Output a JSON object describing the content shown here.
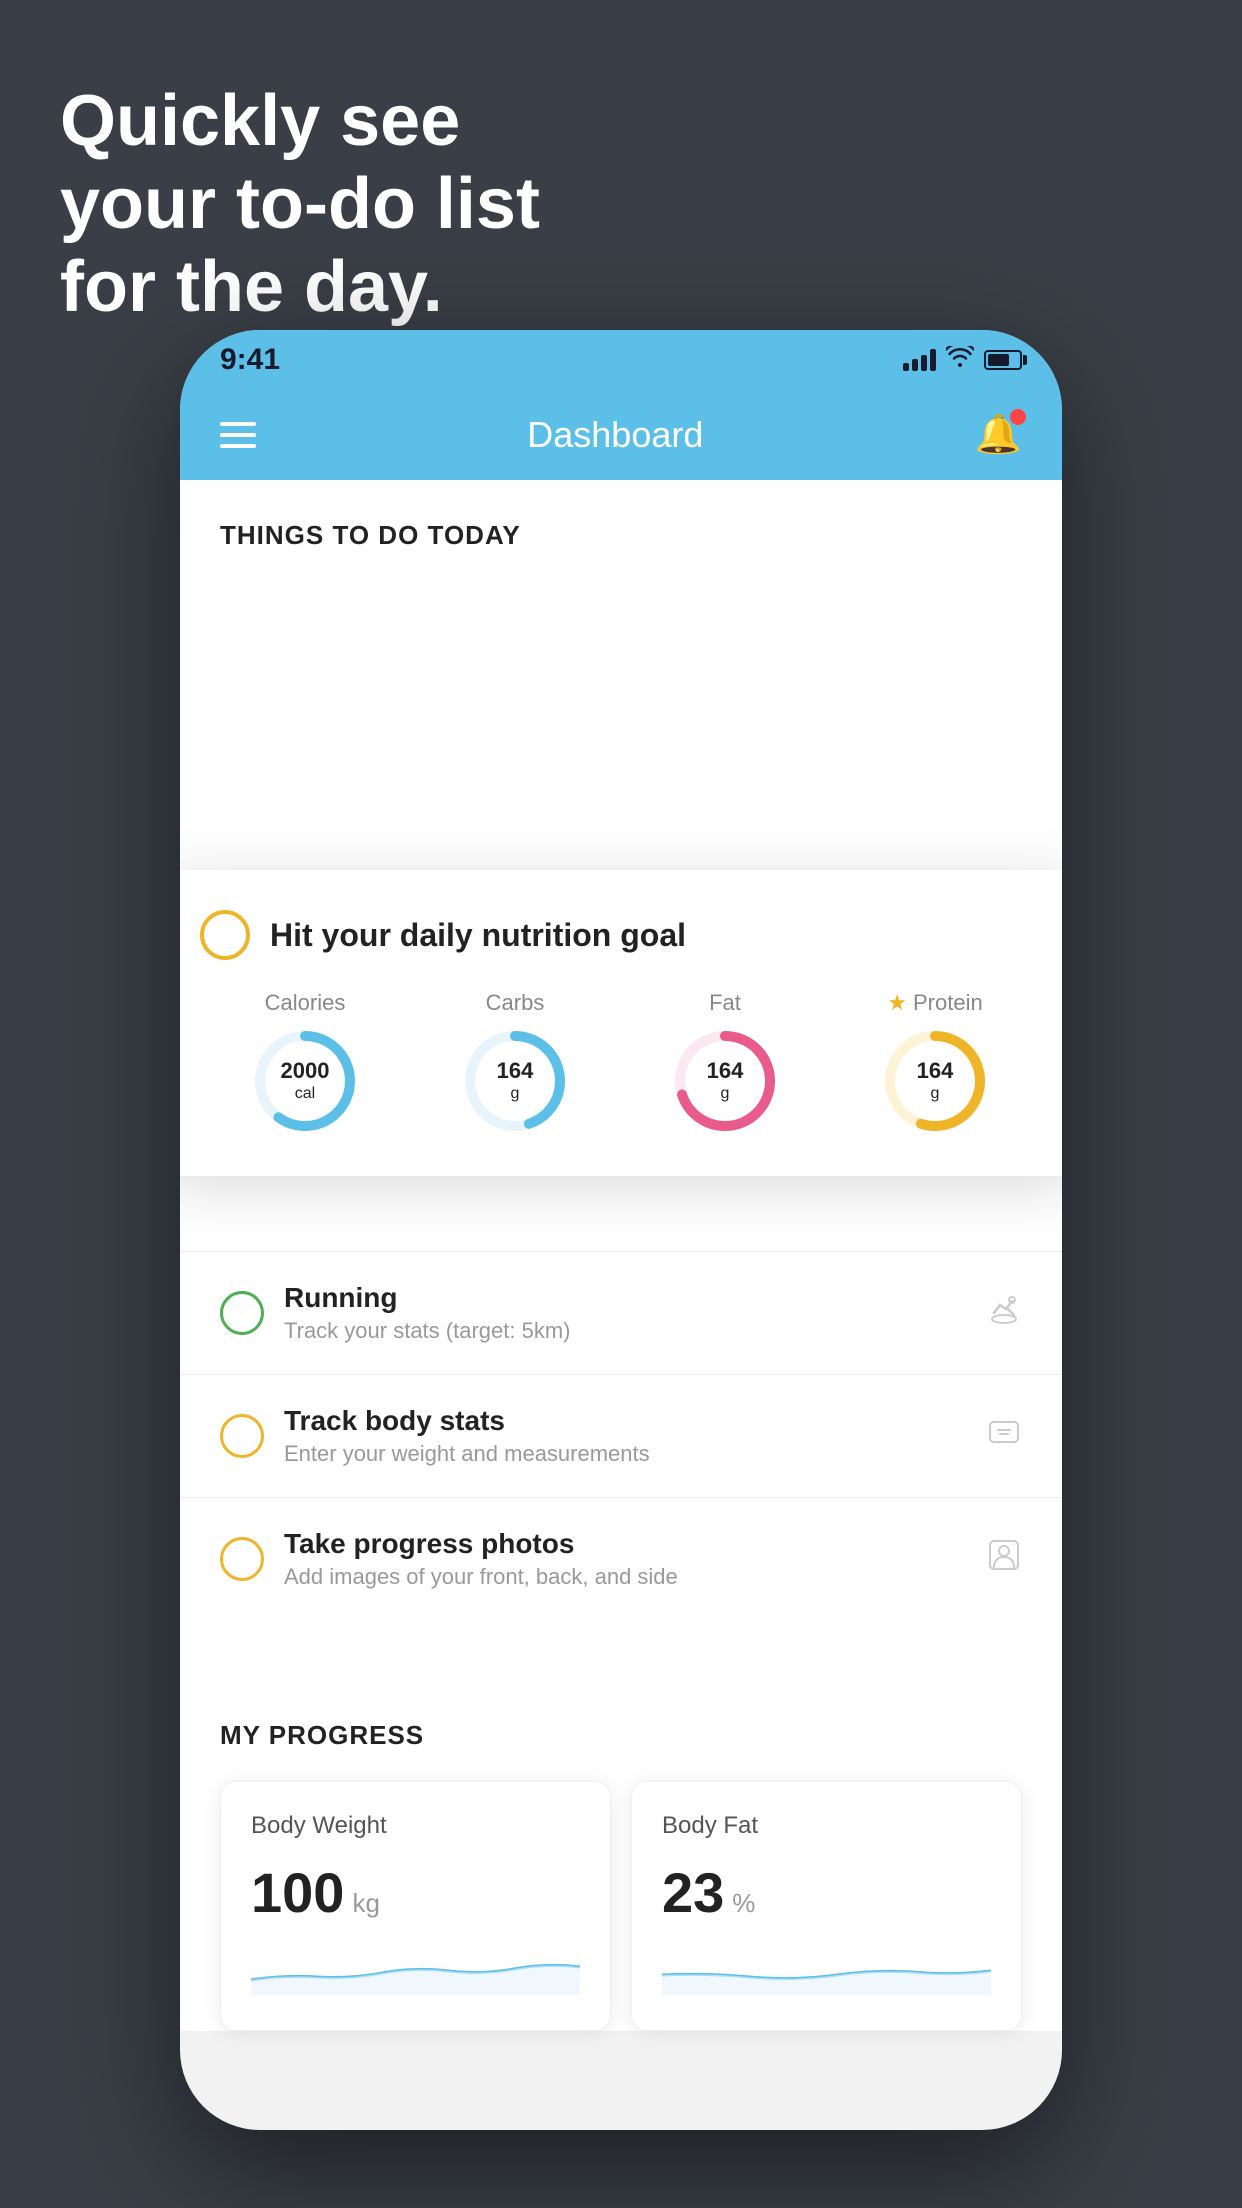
{
  "headline": {
    "line1": "Quickly see",
    "line2": "your to-do list",
    "line3": "for the day."
  },
  "status_bar": {
    "time": "9:41"
  },
  "header": {
    "title": "Dashboard"
  },
  "things_to_do": {
    "section_title": "THINGS TO DO TODAY"
  },
  "nutrition_card": {
    "title": "Hit your daily nutrition goal",
    "items": [
      {
        "label": "Calories",
        "value": "2000",
        "unit": "cal",
        "color": "#5bbfe8",
        "percent": 60
      },
      {
        "label": "Carbs",
        "value": "164",
        "unit": "g",
        "color": "#5bbfe8",
        "percent": 45
      },
      {
        "label": "Fat",
        "value": "164",
        "unit": "g",
        "color": "#e85b8a",
        "percent": 70
      },
      {
        "label": "Protein",
        "value": "164",
        "unit": "g",
        "color": "#f0b429",
        "percent": 55,
        "star": true
      }
    ]
  },
  "todo_items": [
    {
      "title": "Running",
      "subtitle": "Track your stats (target: 5km)",
      "circle_color": "green",
      "icon": "👟"
    },
    {
      "title": "Track body stats",
      "subtitle": "Enter your weight and measurements",
      "circle_color": "yellow",
      "icon": "⚖"
    },
    {
      "title": "Take progress photos",
      "subtitle": "Add images of your front, back, and side",
      "circle_color": "yellow",
      "icon": "👤"
    }
  ],
  "progress": {
    "section_title": "MY PROGRESS",
    "cards": [
      {
        "title": "Body Weight",
        "value": "100",
        "unit": "kg"
      },
      {
        "title": "Body Fat",
        "value": "23",
        "unit": "%"
      }
    ]
  }
}
